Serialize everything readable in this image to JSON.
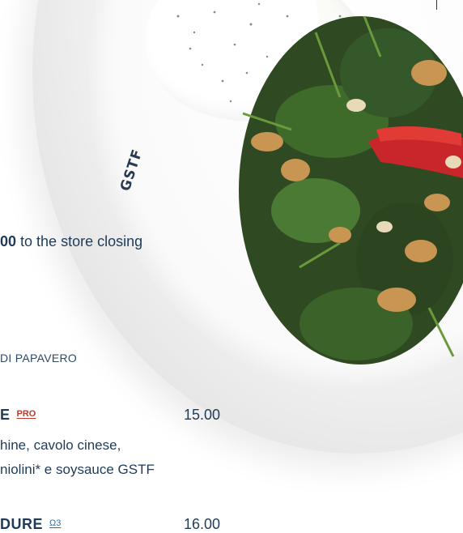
{
  "plate": {
    "stamp": "GSTF"
  },
  "info_line": {
    "bold": "00",
    "rest": " to the store closing"
  },
  "menu": {
    "section_title": "DI PAPAVERO",
    "items": [
      {
        "name": "E",
        "badge": "PRO",
        "badge_color": "#c0392b",
        "price": "15.00",
        "description": [
          "hine, cavolo cinese,",
          "niolini* e soysauce GSTF"
        ]
      },
      {
        "name": "DURE",
        "badge": "Ω3",
        "badge_color": "#2f6f9f",
        "price": "16.00",
        "description": []
      }
    ]
  },
  "colors": {
    "text": "#1f3b57",
    "accent_red": "#c0392b",
    "accent_blue": "#2f6f9f"
  }
}
